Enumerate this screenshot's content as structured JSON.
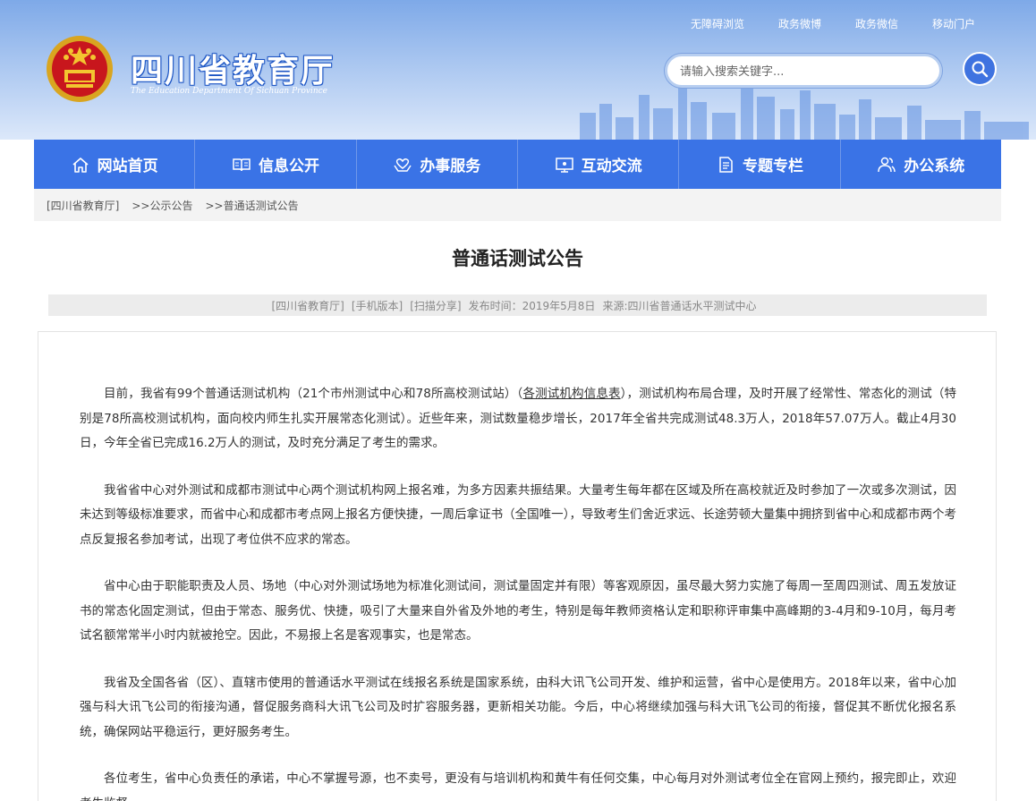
{
  "header": {
    "title": "四川省教育厅",
    "subtitle": "The  Education Department Of Sichuan  Province",
    "toplinks": [
      "无障碍浏览",
      "政务微博",
      "政务微信",
      "移动门户"
    ],
    "search_placeholder": "请输入搜索关键字..."
  },
  "nav": [
    {
      "label": "网站首页",
      "icon": "home-icon"
    },
    {
      "label": "信息公开",
      "icon": "book-icon"
    },
    {
      "label": "办事服务",
      "icon": "hands-icon"
    },
    {
      "label": "互动交流",
      "icon": "monitor-icon"
    },
    {
      "label": "专题专栏",
      "icon": "document-icon"
    },
    {
      "label": "办公系统",
      "icon": "users-icon"
    }
  ],
  "breadcrumb": [
    "[四川省教育厅]",
    ">>公示公告",
    ">>普通话测试公告"
  ],
  "article": {
    "title": "普通话测试公告",
    "meta": {
      "site": "[四川省教育厅]",
      "mobile": "[手机版本]",
      "share": "[扫描分享]",
      "date": "发布时间：2019年5月8日",
      "source": "来源:四川省普通话水平测试中心"
    },
    "p1_before": "目前，我省有99个普通话测试机构（21个市州测试中心和78所高校测试站）（",
    "p1_link": "各测试机构信息表",
    "p1_after": "），测试机构布局合理，及时开展了经常性、常态化的测试（特别是78所高校测试机构，面向校内师生扎实开展常态化测试）。近些年来，测试数量稳步增长，2017年全省共完成测试48.3万人，2018年57.07万人。截止4月30日，今年全省已完成16.2万人的测试，及时充分满足了考生的需求。",
    "p2": "我省省中心对外测试和成都市测试中心两个测试机构网上报名难，为多方因素共振结果。大量考生每年都在区域及所在高校就近及时参加了一次或多次测试，因未达到等级标准要求，而省中心和成都市考点网上报名方便快捷，一周后拿证书（全国唯一），导致考生们舍近求远、长途劳顿大量集中拥挤到省中心和成都市两个考点反复报名参加考试，出现了考位供不应求的常态。",
    "p3": "省中心由于职能职责及人员、场地（中心对外测试场地为标准化测试间，测试量固定并有限）等客观原因，虽尽最大努力实施了每周一至周四测试、周五发放证书的常态化固定测试，但由于常态、服务优、快捷，吸引了大量来自外省及外地的考生，特别是每年教师资格认定和职称评审集中高峰期的3-4月和9-10月，每月考试名额常常半小时内就被抢空。因此，不易报上名是客观事实，也是常态。",
    "p4": "我省及全国各省（区）、直辖市使用的普通话水平测试在线报名系统是国家系统，由科大讯飞公司开发、维护和运营，省中心是使用方。2018年以来，省中心加强与科大讯飞公司的衔接沟通，督促服务商科大讯飞公司及时扩容服务器，更新相关功能。今后，中心将继续加强与科大讯飞公司的衔接，督促其不断优化报名系统，确保网站平稳运行，更好服务考生。",
    "p5": "各位考生，省中心负责任的承诺，中心不掌握号源，也不卖号，更没有与培训机构和黄牛有任何交集，中心每月对外测试考位全在官网上预约，报完即止，欢迎考生监督。"
  },
  "colors": {
    "nav": "#3a73e6",
    "header_top": "#7ea9e8",
    "search_button": "#3f73e0"
  }
}
